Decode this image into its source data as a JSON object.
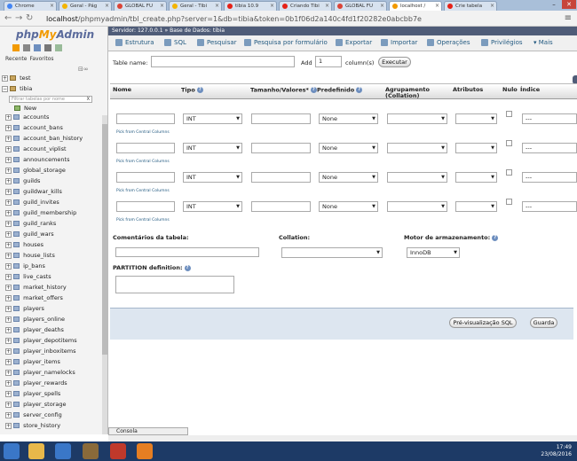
{
  "browser": {
    "tabs": [
      {
        "label": "Chrome",
        "color": "#4285f4"
      },
      {
        "label": "Geral - Pág",
        "color": "#f4b400"
      },
      {
        "label": "GLOBAL FU",
        "color": "#db4437"
      },
      {
        "label": "Geral - Tibi",
        "color": "#f4b400"
      },
      {
        "label": "tibia 10.9",
        "color": "#e62117"
      },
      {
        "label": "Criando Tibi",
        "color": "#e62117"
      },
      {
        "label": "GLOBAL FU",
        "color": "#db4437"
      },
      {
        "label": "localhost /",
        "color": "#f29a00",
        "active": true
      },
      {
        "label": "Crie tabela",
        "color": "#e62117"
      }
    ],
    "url_host": "localhost",
    "url_path": "/phpmyadmin/tbl_create.php?server=1&db=tibia&token=0b1f06d2a140c4fd1f20282e0abcbb7e",
    "win_min": "–",
    "win_close": "✕"
  },
  "sidebar": {
    "logo_php": "php",
    "logo_my": "My",
    "logo_admin": "Admin",
    "links": [
      "Recente",
      "Favoritos"
    ],
    "db_test": "test",
    "db_tibia": "tibia",
    "filter_placeholder": "Filtrar tabelas por nome",
    "new_label": "New",
    "tables": [
      "accounts",
      "account_bans",
      "account_ban_history",
      "account_viplist",
      "announcements",
      "global_storage",
      "guilds",
      "guildwar_kills",
      "guild_invites",
      "guild_membership",
      "guild_ranks",
      "guild_wars",
      "houses",
      "house_lists",
      "ip_bans",
      "live_casts",
      "market_history",
      "market_offers",
      "players",
      "players_online",
      "player_deaths",
      "player_depotitems",
      "player_inboxitems",
      "player_items",
      "player_namelocks",
      "player_rewards",
      "player_spells",
      "player_storage",
      "server_config",
      "store_history"
    ]
  },
  "breadcrumb": {
    "server": "Servidor: 127.0.0.1",
    "sep": "»",
    "db": "Base de Dados: tibia"
  },
  "topmenu": [
    "Estrutura",
    "SQL",
    "Pesquisar",
    "Pesquisa por formulário",
    "Exportar",
    "Importar",
    "Operações",
    "Privilégios",
    "Mais"
  ],
  "form": {
    "table_name_label": "Table name:",
    "add_label": "Add",
    "add_value": "1",
    "columns_label": "column(s)",
    "execute_label": "Executar",
    "headers": [
      "Nome",
      "Tipo",
      "Tamanho/Valores*",
      "Predefinido",
      "Agrupamento (Collation)",
      "Atributos",
      "Nulo",
      "Índice"
    ],
    "type_value": "INT",
    "default_value": "None",
    "index_value": "---",
    "pick_label": "Pick from Central Columns",
    "comments_label": "Comentários da tabela:",
    "collation_label": "Collation:",
    "engine_label": "Motor de armazenamento:",
    "engine_value": "InnoDB",
    "partition_label": "PARTITION definition:",
    "preview_label": "Pré-visualização SQL",
    "save_label": "Guarda",
    "console_label": "Consola"
  },
  "taskbar": {
    "time": "17:49",
    "date": "23/08/2016"
  }
}
